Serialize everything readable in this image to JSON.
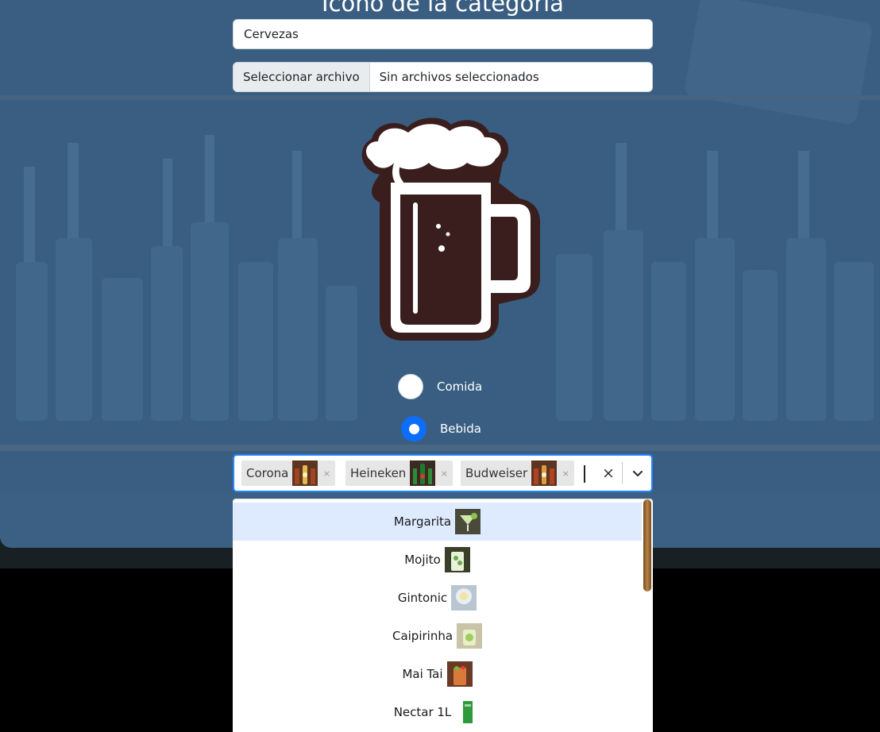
{
  "form": {
    "heading": "Icono de la categoria",
    "name_value": "Cervezas",
    "file_button": "Seleccionar archivo",
    "file_status": "Sin archivos seleccionados"
  },
  "category_icon": "beer-mug-icon",
  "radios": [
    {
      "label": "Comida",
      "checked": false
    },
    {
      "label": "Bebida",
      "checked": true
    }
  ],
  "multiselect": {
    "selected": [
      {
        "label": "Corona",
        "remove": "×"
      },
      {
        "label": "Heineken",
        "remove": "×"
      },
      {
        "label": "Budweiser",
        "remove": "×"
      }
    ],
    "clear": "×"
  },
  "dropdown": {
    "options": [
      {
        "label": "Margarita"
      },
      {
        "label": "Mojito"
      },
      {
        "label": "Gintonic"
      },
      {
        "label": "Caipirinha"
      },
      {
        "label": "Mai Tai"
      },
      {
        "label": "Nectar 1L"
      }
    ]
  },
  "colors": {
    "accent": "#0d6efd",
    "focus_border": "#2684ff",
    "option_highlight": "#deebff",
    "overlay": "#4a78a8"
  }
}
